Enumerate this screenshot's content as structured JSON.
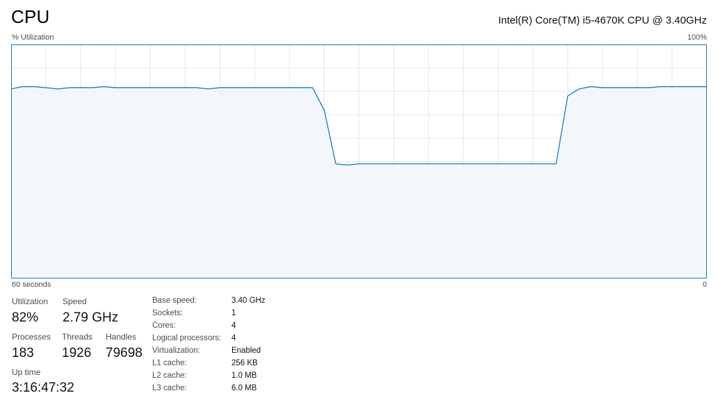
{
  "header": {
    "title": "CPU",
    "cpu_model": "Intel(R) Core(TM) i5-4670K CPU @ 3.40GHz"
  },
  "graph": {
    "y_label": "% Utilization",
    "y_max_label": "100%",
    "x_left_label": "60 seconds",
    "x_right_label": "0",
    "line_color": "#117dbb",
    "fill_color": "#f1f6fa",
    "grid_color": "#d9eaf4"
  },
  "chart_data": {
    "type": "area",
    "ylim": [
      0,
      100
    ],
    "xlim": [
      60,
      0
    ],
    "grid": true,
    "x": [
      60,
      59,
      58,
      57,
      56,
      55,
      54,
      53,
      52,
      51,
      50,
      49,
      48,
      47,
      46,
      45,
      44,
      43,
      42,
      41,
      40,
      39,
      38,
      37,
      36,
      35,
      34,
      33,
      32,
      31,
      30,
      29,
      28,
      27,
      26,
      25,
      24,
      23,
      22,
      21,
      20,
      19,
      18,
      17,
      16,
      15,
      14,
      13,
      12,
      11,
      10,
      9,
      8,
      7,
      6,
      5,
      4,
      3,
      2,
      1,
      0
    ],
    "values": [
      81,
      82,
      82,
      81.5,
      81,
      81.5,
      81.5,
      81.5,
      82,
      81.5,
      81.5,
      81.5,
      81.5,
      81.5,
      81.5,
      81.5,
      81.5,
      81,
      81.5,
      81.5,
      81.5,
      81.5,
      81.5,
      81.5,
      81.5,
      81.5,
      81.5,
      72,
      49,
      48.5,
      49,
      49,
      49,
      49,
      49,
      49,
      49,
      49,
      49,
      49,
      49,
      49,
      49,
      49,
      49,
      49,
      49,
      49,
      78,
      81,
      82,
      81.5,
      81.5,
      81.5,
      81.5,
      81.5,
      82,
      82,
      82,
      82,
      82
    ]
  },
  "stats": {
    "utilization_label": "Utilization",
    "utilization_value": "82%",
    "speed_label": "Speed",
    "speed_value": "2.79 GHz",
    "processes_label": "Processes",
    "processes_value": "183",
    "threads_label": "Threads",
    "threads_value": "1926",
    "handles_label": "Handles",
    "handles_value": "79698",
    "uptime_label": "Up time",
    "uptime_value": "3:16:47:32"
  },
  "specs": [
    {
      "label": "Base speed:",
      "value": "3.40 GHz"
    },
    {
      "label": "Sockets:",
      "value": "1"
    },
    {
      "label": "Cores:",
      "value": "4"
    },
    {
      "label": "Logical processors:",
      "value": "4"
    },
    {
      "label": "Virtualization:",
      "value": "Enabled"
    },
    {
      "label": "L1 cache:",
      "value": "256 KB"
    },
    {
      "label": "L2 cache:",
      "value": "1.0 MB"
    },
    {
      "label": "L3 cache:",
      "value": "6.0 MB"
    }
  ]
}
